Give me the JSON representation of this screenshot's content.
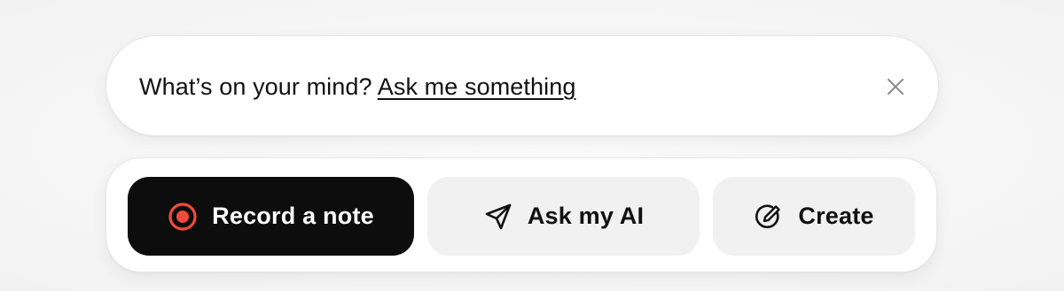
{
  "prompt": {
    "lead_text": "What’s on your mind?",
    "link_text": "Ask me something",
    "close_icon": "close-icon"
  },
  "actions": [
    {
      "label": "Record a note",
      "icon": "record-icon",
      "accent_color": "#ef4a3c"
    },
    {
      "label": "Ask my AI",
      "icon": "send-icon"
    },
    {
      "label": "Create",
      "icon": "edit-circle-icon"
    }
  ],
  "colors": {
    "primary_button_bg": "#0d0d0d",
    "secondary_button_bg": "#f1f1f1",
    "record_accent": "#ef4a3c"
  }
}
